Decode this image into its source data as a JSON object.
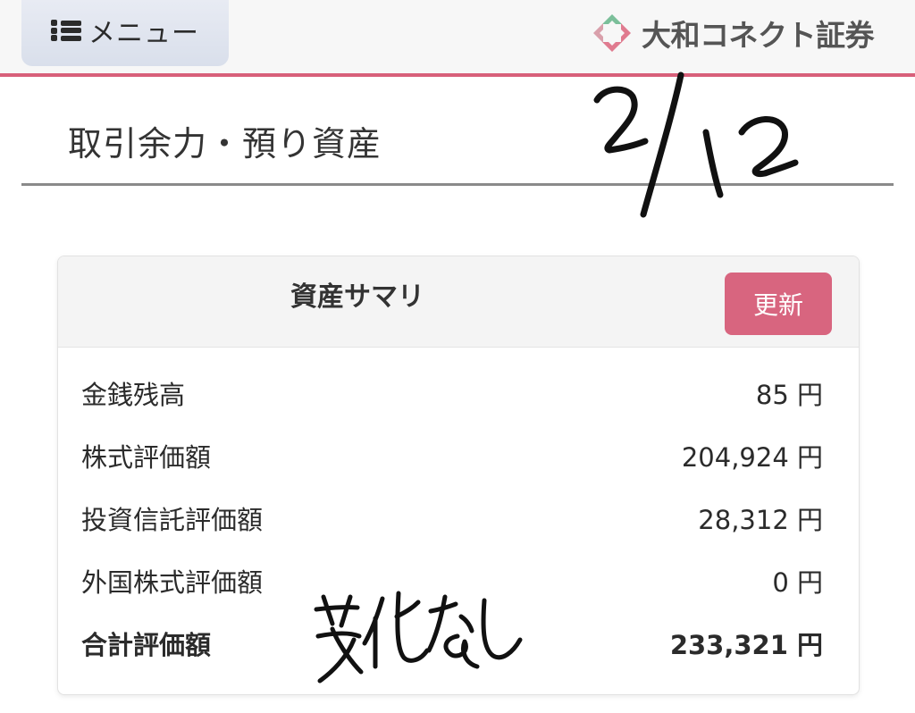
{
  "header": {
    "menu_label": "メニュー",
    "logo_text": "大和コネクト証券",
    "accent_color": "#d8607a"
  },
  "page": {
    "title": "取引余力・預り資産"
  },
  "annotations": {
    "date": "2/12",
    "note": "変化なし"
  },
  "summary": {
    "title": "資産サマリ",
    "refresh_label": "更新",
    "rows": [
      {
        "label": "金銭残高",
        "value": "85 円"
      },
      {
        "label": "株式評価額",
        "value": "204,924 円"
      },
      {
        "label": "投資信託評価額",
        "value": "28,312 円"
      },
      {
        "label": "外国株式評価額",
        "value": "0 円"
      },
      {
        "label": "合計評価額",
        "value": "233,321 円"
      }
    ]
  }
}
